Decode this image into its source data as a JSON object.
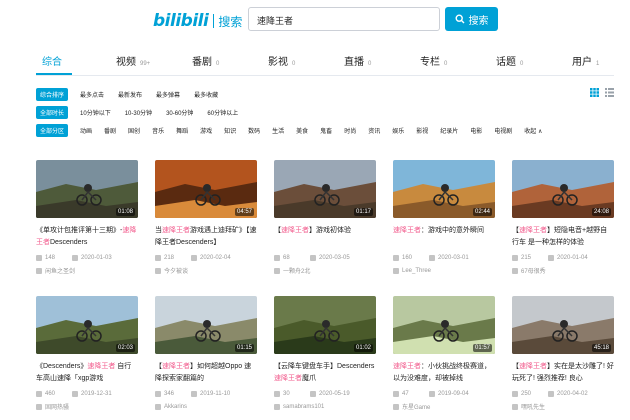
{
  "header": {
    "logo": "bilibili",
    "logo_sub": "搜索",
    "search_value": "速降王者",
    "search_button": "搜索"
  },
  "type_tabs": [
    {
      "label": "综合",
      "count": ""
    },
    {
      "label": "视频",
      "count": "99+"
    },
    {
      "label": "番剧",
      "count": "0"
    },
    {
      "label": "影视",
      "count": "0"
    },
    {
      "label": "直播",
      "count": "0"
    },
    {
      "label": "专栏",
      "count": "0"
    },
    {
      "label": "话题",
      "count": "0"
    },
    {
      "label": "用户",
      "count": "1"
    }
  ],
  "filters": {
    "sort": {
      "tag": "综合排序",
      "options": [
        "最多点击",
        "最新发布",
        "最多弹幕",
        "最多收藏"
      ]
    },
    "duration": {
      "tag": "全部时长",
      "options": [
        "10分钟以下",
        "10-30分钟",
        "30-60分钟",
        "60分钟以上"
      ]
    },
    "zone": {
      "tag": "全部分区",
      "options": [
        "动画",
        "番剧",
        "国创",
        "音乐",
        "舞蹈",
        "游戏",
        "知识",
        "数码",
        "生活",
        "美食",
        "鬼畜",
        "时尚",
        "资讯",
        "娱乐",
        "影视",
        "纪录片",
        "电影",
        "电视剧",
        "收起 ∧"
      ]
    }
  },
  "keyword": "速降王者",
  "cards": [
    {
      "duration": "01:08",
      "pre": "《单攻计包推评第十三期》-",
      "kw": "速降王者",
      "post": "Descenders",
      "views": "148",
      "date": "2020-01-03",
      "uploader": "闲鱼之圣剑"
    },
    {
      "duration": "04:57",
      "pre": "当",
      "kw": "速降王者",
      "post": "游戏遇上迪拜矿》【速降王者Descenders】",
      "views": "218",
      "date": "2020-02-04",
      "uploader": "今夕被谈"
    },
    {
      "duration": "01:17",
      "pre": "【",
      "kw": "速降王者",
      "post": "】游戏初体验",
      "views": "68",
      "date": "2020-03-05",
      "uploader": "一颗舟2北"
    },
    {
      "duration": "02:44",
      "pre": "",
      "kw": "速降王者",
      "post": "：游戏中的意外瞬间",
      "views": "160",
      "date": "2020-03-01",
      "uploader": "Lee_Three"
    },
    {
      "duration": "24:08",
      "pre": "【",
      "kw": "速降王者",
      "post": "】短隐电音+越野自行车 是一种怎样的体验",
      "views": "215",
      "date": "2020-01-04",
      "uploader": "67母很秀"
    },
    {
      "duration": "02:03",
      "pre": "《Descenders》",
      "kw": "速降王者",
      "post": " 自行车高山速降「xgp游戏",
      "views": "460",
      "date": "2019-12-31",
      "uploader": "固网热骚"
    },
    {
      "duration": "01:15",
      "pre": "【",
      "kw": "速降王者",
      "post": "】如何超越Oppo 速降探索家翻篇的",
      "views": "346",
      "date": "2019-11-10",
      "uploader": "Akkarins"
    },
    {
      "duration": "01:02",
      "pre": "【云降车键盘车手】Descenders",
      "kw": "速降王者",
      "post": "魔爪",
      "views": "30",
      "date": "2020-05-19",
      "uploader": "samabrams101"
    },
    {
      "duration": "01:57",
      "pre": "",
      "kw": "速降王者",
      "post": "：小伙挑战终极赛道，以为没难度，却被掉线",
      "views": "47",
      "date": "2019-09-04",
      "uploader": "东星Game"
    },
    {
      "duration": "45:18",
      "pre": "【",
      "kw": "速降王者",
      "post": "】实在是太沙雕了! 好玩死了! 强烈推荐! 良心",
      "views": "250",
      "date": "2020-04-02",
      "uploader": "嘿吼先生"
    }
  ],
  "colors": {
    "accent": "#00a1d6",
    "keyword": "#f25d8e",
    "meta": "#999999"
  }
}
